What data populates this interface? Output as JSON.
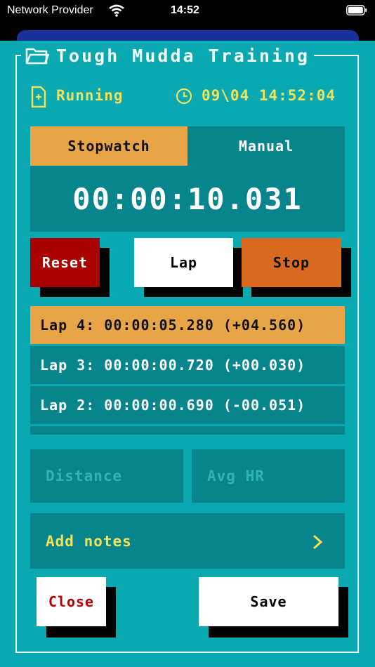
{
  "status_bar": {
    "carrier": "Network Provider",
    "time": "14:52"
  },
  "app": {
    "title": "Tough Mudda Training"
  },
  "session": {
    "state": "Running",
    "datetime": "09\\04 14:52:04"
  },
  "tabs": [
    {
      "label": "Stopwatch",
      "active": true
    },
    {
      "label": "Manual",
      "active": false
    }
  ],
  "timer": {
    "display": "00:00:10.031"
  },
  "controls": {
    "reset": "Reset",
    "lap": "Lap",
    "stop": "Stop"
  },
  "laps": [
    {
      "text": "Lap 4: 00:00:05.280 (+04.560)",
      "highlight": true
    },
    {
      "text": "Lap 3: 00:00:00.720 (+00.030)",
      "highlight": false
    },
    {
      "text": "Lap 2: 00:00:00.690 (-00.051)",
      "highlight": false
    }
  ],
  "fields": {
    "distance_placeholder": "Distance",
    "hr_placeholder": "Avg HR"
  },
  "notes": {
    "label": "Add notes"
  },
  "actions": {
    "close": "Close",
    "save": "Save"
  },
  "colors": {
    "background": "#0aa8b0",
    "panel": "#07848c",
    "accent_orange": "#e7a548",
    "yellow_text": "#f0e25a",
    "reset_red": "#a90000",
    "stop_orange": "#d8691f"
  },
  "icons": [
    "wifi-icon",
    "battery-icon",
    "folder-icon",
    "state-icon",
    "clock-icon",
    "chevron-right-icon"
  ]
}
